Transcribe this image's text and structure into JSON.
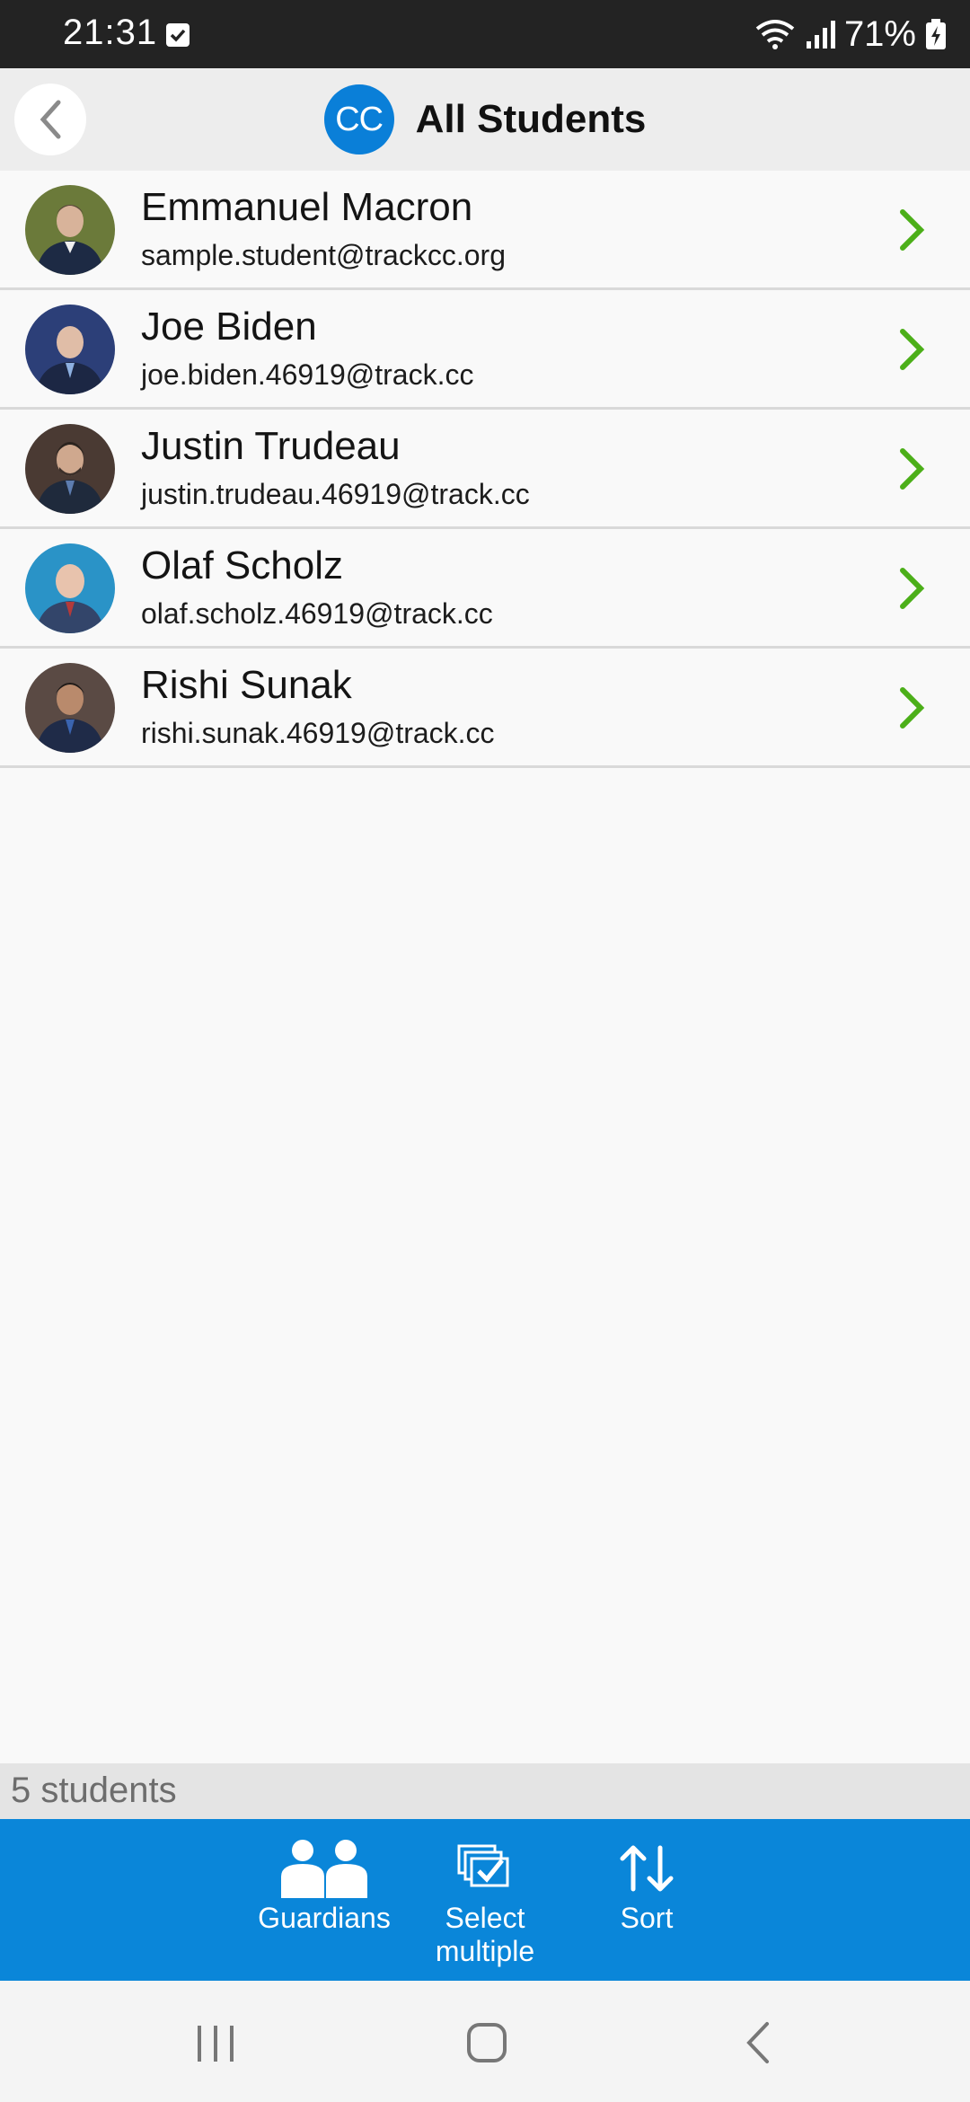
{
  "status_bar": {
    "time": "21:31",
    "battery_percent": "71%",
    "icons": [
      "checkbox-notification-icon",
      "wifi-icon",
      "signal-icon",
      "battery-charging-icon"
    ]
  },
  "header": {
    "title": "All Students",
    "logo_text": "CC",
    "back_icon": "chevron-left-icon"
  },
  "students": [
    {
      "name": "Emmanuel Macron",
      "email": "sample.student@trackcc.org",
      "avatar_colors": [
        "#6b7a3a",
        "#1d2a44"
      ]
    },
    {
      "name": "Joe Biden",
      "email": "joe.biden.46919@track.cc",
      "avatar_colors": [
        "#2c3f78",
        "#1c2744"
      ]
    },
    {
      "name": "Justin Trudeau",
      "email": "justin.trudeau.46919@track.cc",
      "avatar_colors": [
        "#4a3a33",
        "#1f2a3c"
      ]
    },
    {
      "name": "Olaf Scholz",
      "email": "olaf.scholz.46919@track.cc",
      "avatar_colors": [
        "#2a93c7",
        "#33456a"
      ]
    },
    {
      "name": "Rishi Sunak",
      "email": "rishi.sunak.46919@track.cc",
      "avatar_colors": [
        "#5a4a44",
        "#1f2b48"
      ]
    }
  ],
  "footer": {
    "count_text": "5 students"
  },
  "toolbar": {
    "guardians_label": "Guardians",
    "select_label_line1": "Select",
    "select_label_line2": "multiple",
    "sort_label": "Sort"
  },
  "colors": {
    "accent_blue": "#0a86d9",
    "chevron_green": "#4caf19",
    "header_bg": "#ededed"
  }
}
